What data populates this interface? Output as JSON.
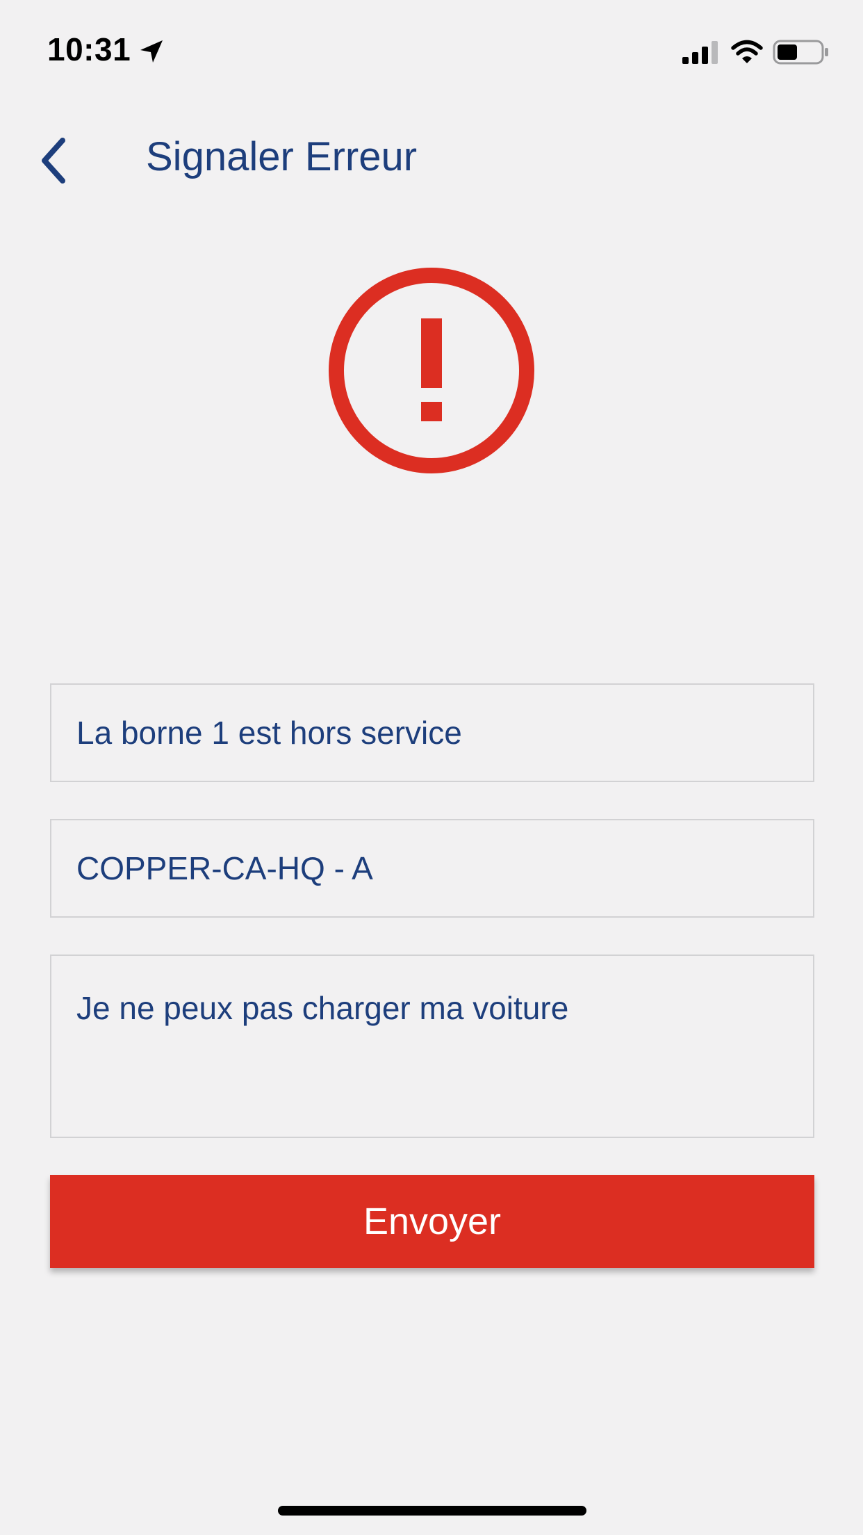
{
  "status_bar": {
    "time": "10:31",
    "icons": [
      "location-arrow-icon",
      "cellular-signal-icon",
      "wifi-icon",
      "battery-icon"
    ]
  },
  "header": {
    "back_icon": "chevron-left-icon",
    "title": "Signaler Erreur"
  },
  "alert": {
    "icon": "exclamation-circle-icon",
    "color": "#dc2e22"
  },
  "form": {
    "subject_value": "La borne 1 est hors service",
    "station_value": "COPPER-CA-HQ - A",
    "message_value": "Je ne peux pas charger ma voiture",
    "submit_label": "Envoyer"
  },
  "colors": {
    "text": "#1d3e7c",
    "accent": "#dc2e22",
    "background": "#f2f1f2",
    "field_border": "#d2d2d4"
  }
}
